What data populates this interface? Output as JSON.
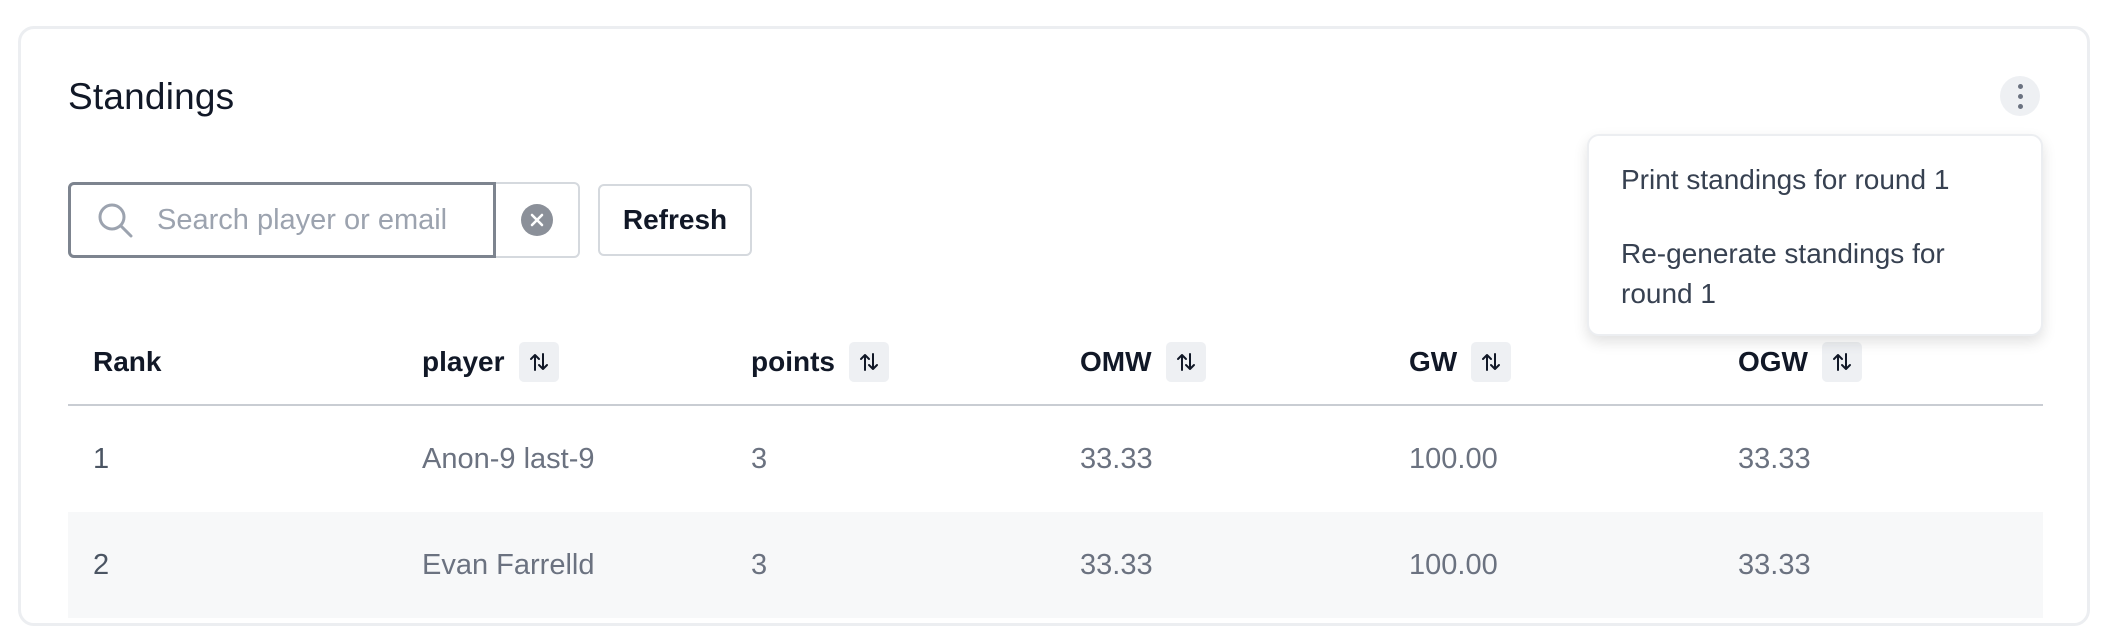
{
  "card": {
    "title": "Standings"
  },
  "toolbar": {
    "search_placeholder": "Search player or email",
    "refresh_label": "Refresh"
  },
  "menu": {
    "items": [
      "Print standings for round 1",
      "Re-generate standings for round 1"
    ]
  },
  "table": {
    "columns": [
      "Rank",
      "player",
      "points",
      "OMW",
      "GW",
      "OGW"
    ],
    "rows": [
      [
        "1",
        "Anon-9 last-9",
        "3",
        "33.33",
        "100.00",
        "33.33"
      ],
      [
        "2",
        "Evan Farrelld",
        "3",
        "33.33",
        "100.00",
        "33.33"
      ]
    ]
  },
  "icons": {
    "search": "search-icon",
    "clear": "clear-icon",
    "sort": "sort-icon",
    "more": "kebab-icon"
  }
}
